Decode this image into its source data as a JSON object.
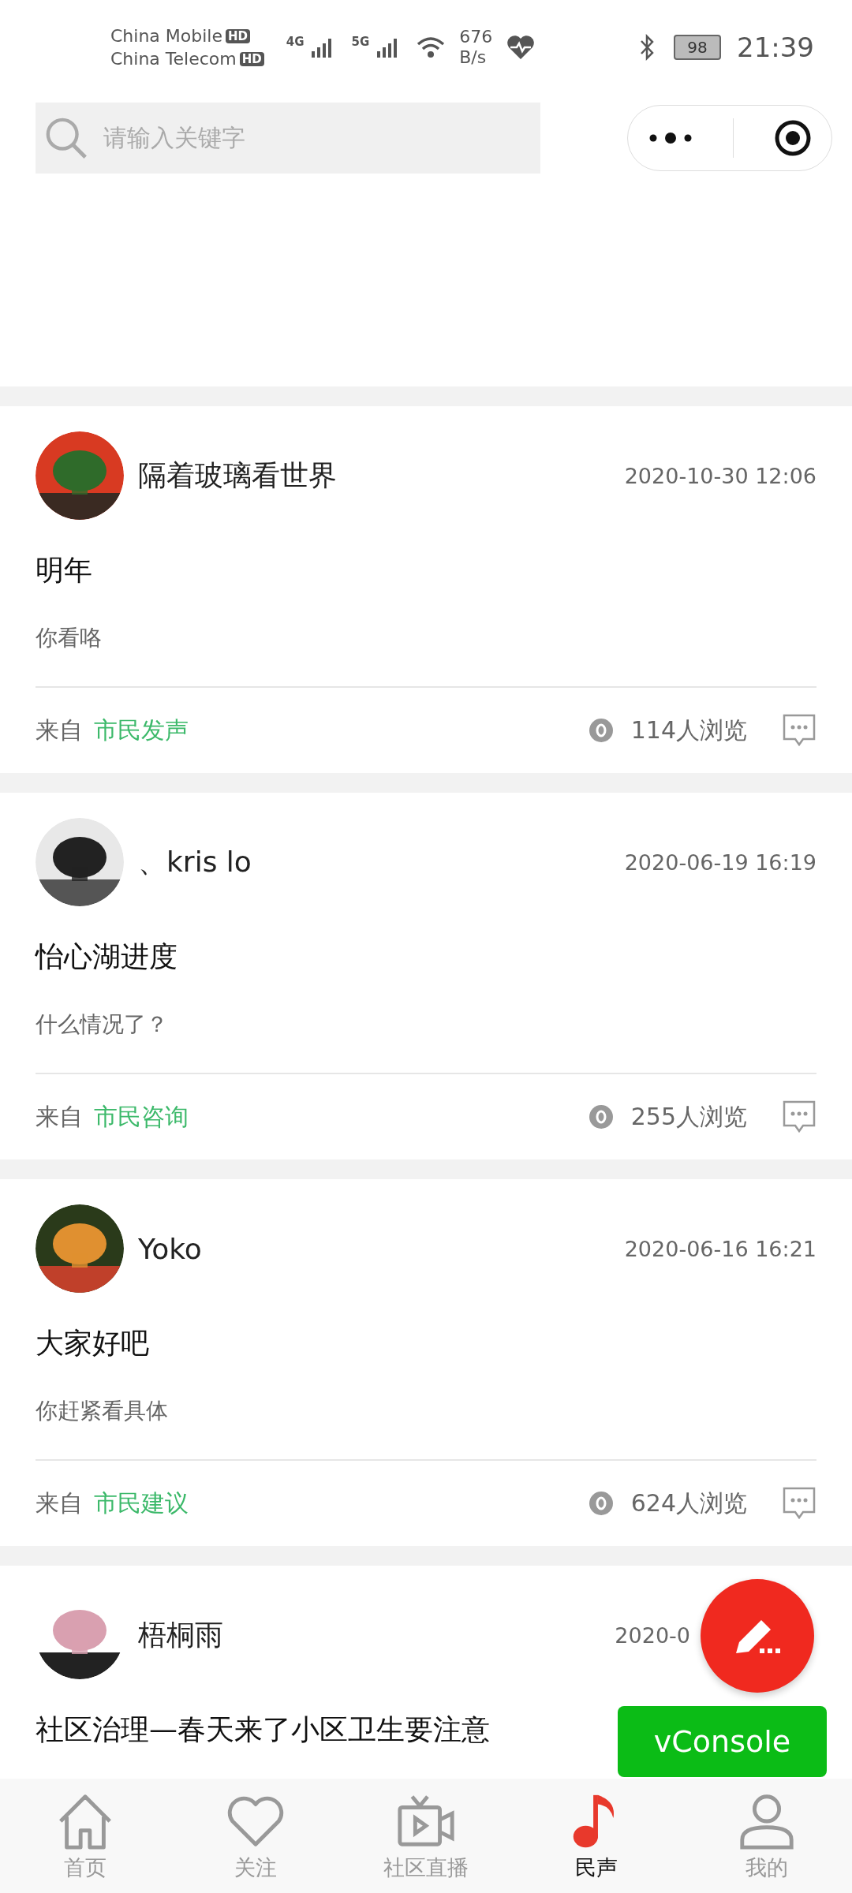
{
  "status_bar": {
    "carriers": [
      "China Mobile",
      "China Telecom"
    ],
    "carrier_badges": [
      "HD",
      "HD"
    ],
    "network_labels": [
      "4G",
      "5G"
    ],
    "speed": [
      "676",
      "B/s"
    ],
    "battery": "98",
    "time": "21:39"
  },
  "search": {
    "placeholder": "请输入关键字"
  },
  "posts": [
    {
      "author": "隔着玻璃看世界",
      "time": "2020-10-30 12:06",
      "title": "明年",
      "body": "你看咯",
      "from_label": "来自",
      "category": "市民发声",
      "views": "114人浏览"
    },
    {
      "author": "、kris lo",
      "time": "2020-06-19 16:19",
      "title": "怡心湖进度",
      "body": "什么情况了？",
      "from_label": "来自",
      "category": "市民咨询",
      "views": "255人浏览"
    },
    {
      "author": "Yoko",
      "time": "2020-06-16 16:21",
      "title": "大家好吧",
      "body": "你赶紧看具体",
      "from_label": "来自",
      "category": "市民建议",
      "views": "624人浏览"
    },
    {
      "author": "梧桐雨",
      "time": "2020-0",
      "title": "社区治理—春天来了小区卫生要注意"
    }
  ],
  "vconsole": "vConsole",
  "tabs": [
    {
      "label": "首页",
      "kind": "home",
      "selected": false
    },
    {
      "label": "关注",
      "kind": "heart",
      "selected": false
    },
    {
      "label": "社区直播",
      "kind": "video",
      "selected": false
    },
    {
      "label": "民声",
      "kind": "music",
      "selected": true
    },
    {
      "label": "我的",
      "kind": "person",
      "selected": false
    }
  ]
}
